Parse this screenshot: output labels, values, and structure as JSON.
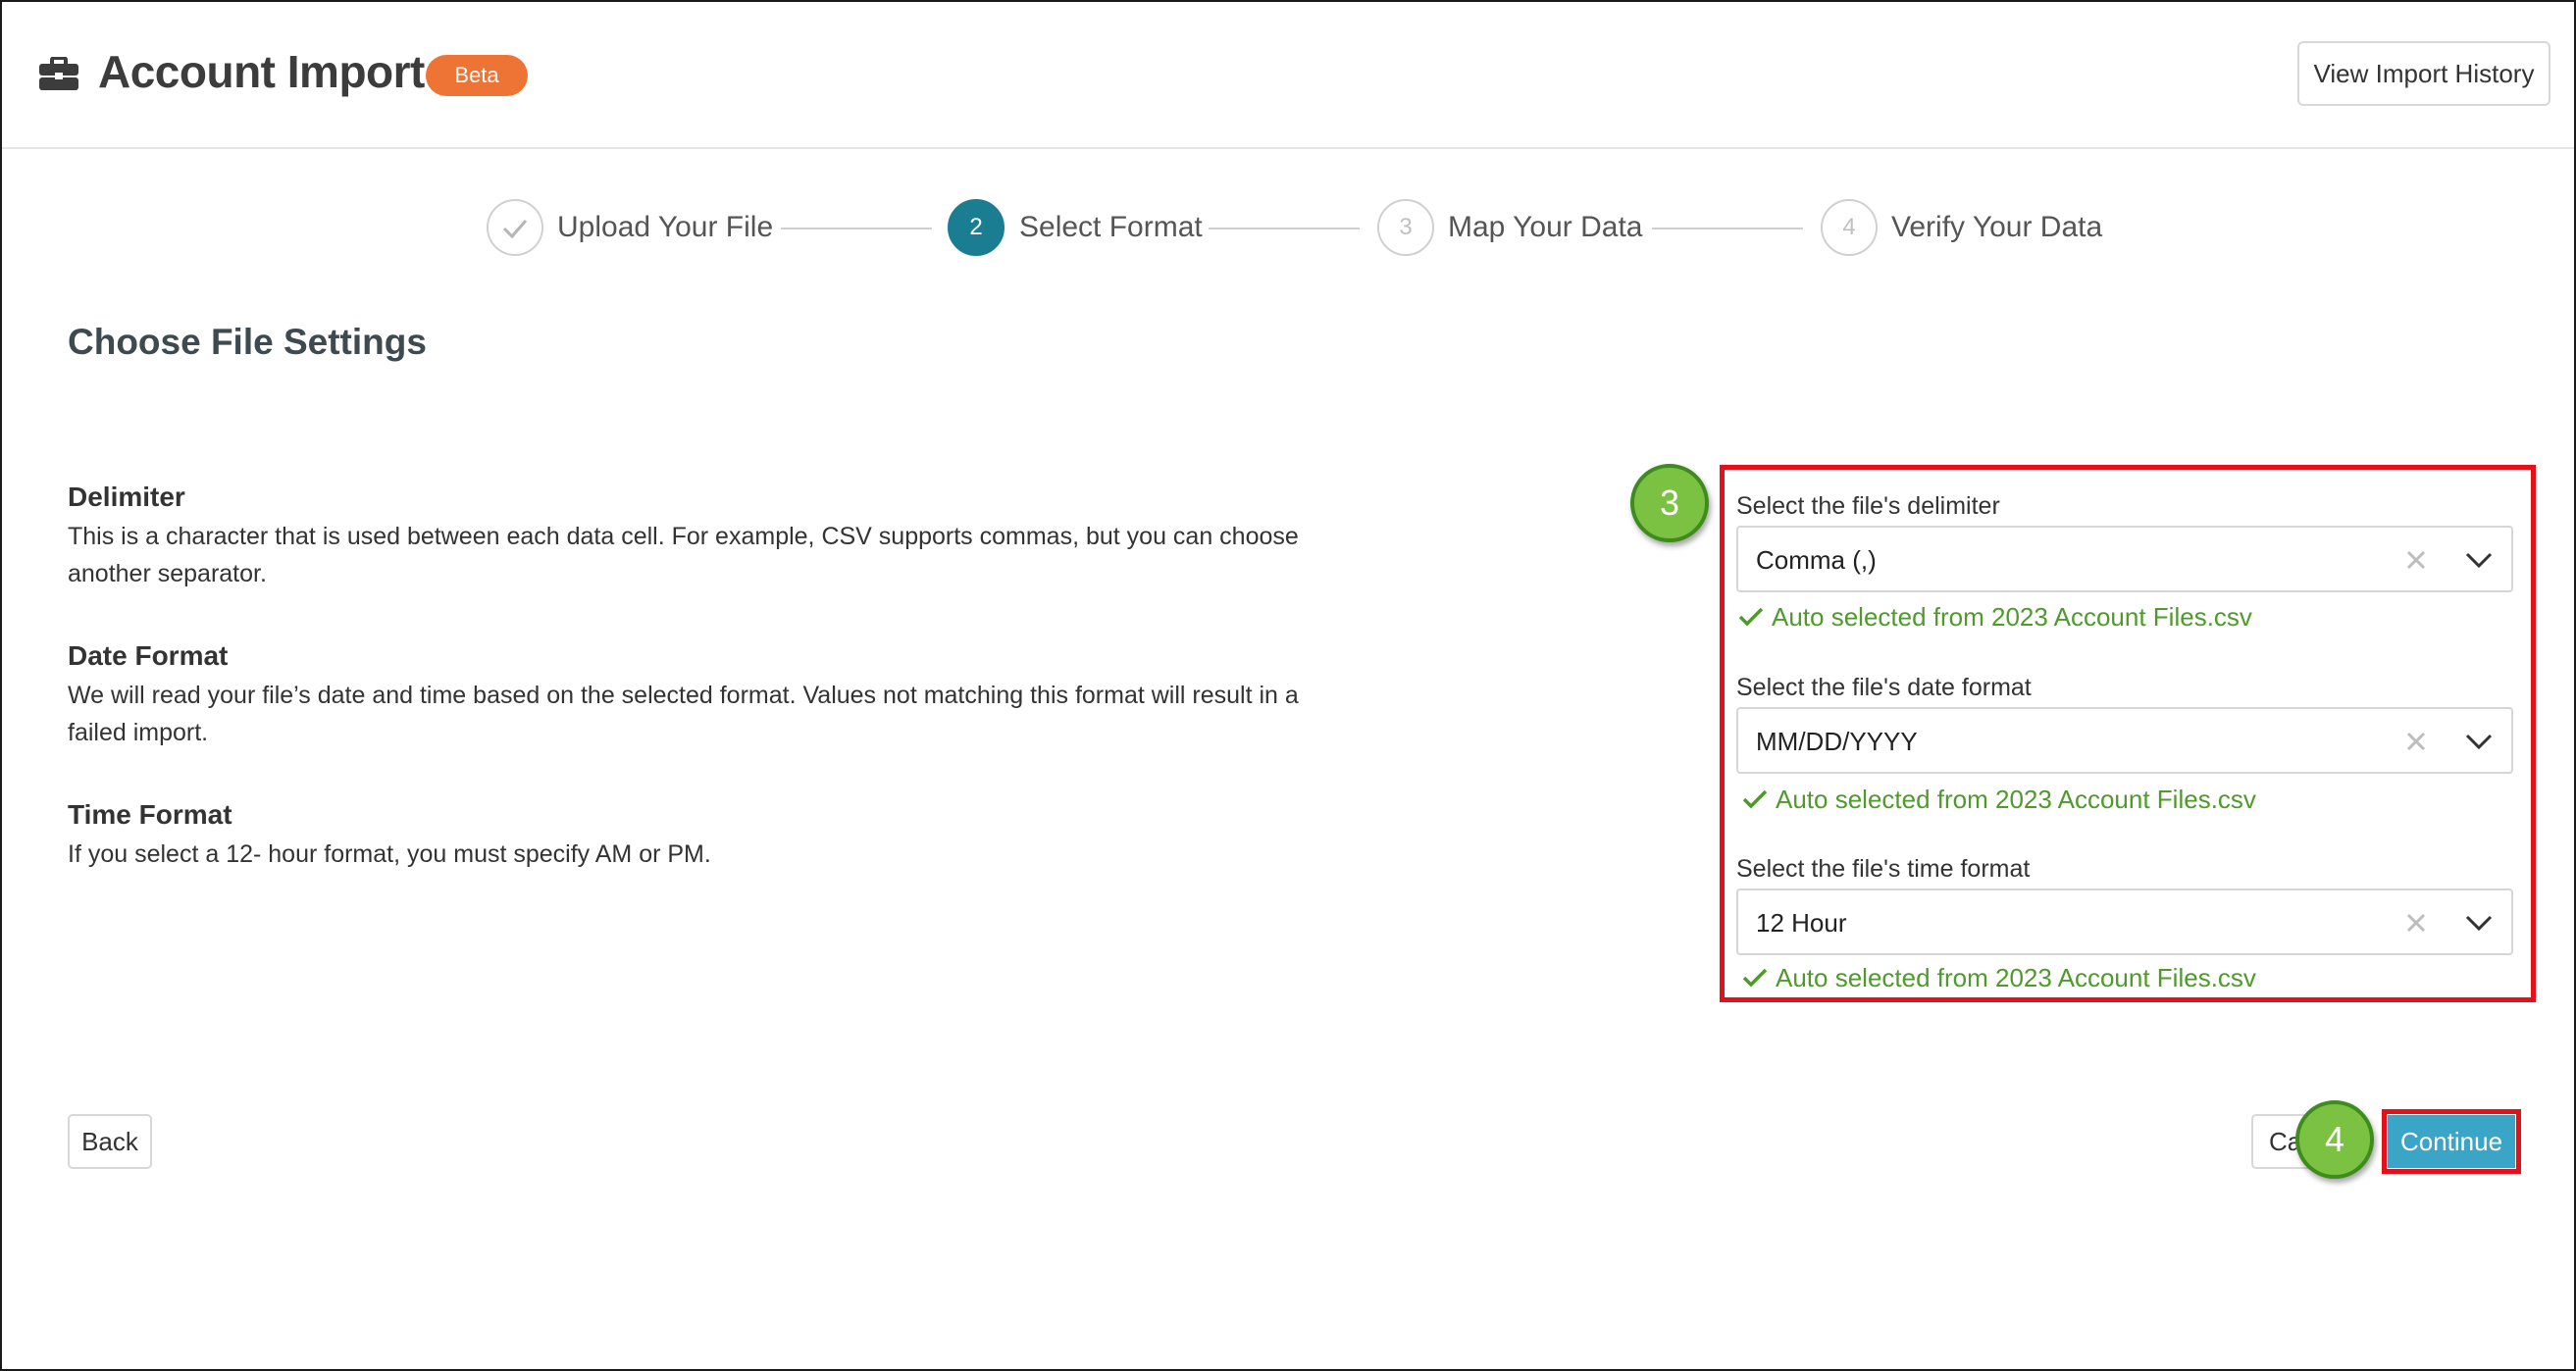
{
  "header": {
    "title": "Account Import",
    "badge": "Beta",
    "history_button": "View Import History"
  },
  "steps": [
    {
      "number": "",
      "label": "Upload Your File",
      "state": "completed"
    },
    {
      "number": "2",
      "label": "Select Format",
      "state": "active"
    },
    {
      "number": "3",
      "label": "Map Your Data",
      "state": "upcoming"
    },
    {
      "number": "4",
      "label": "Verify Your Data",
      "state": "upcoming"
    }
  ],
  "main": {
    "section_title": "Choose File Settings",
    "info": [
      {
        "heading": "Delimiter",
        "text": "This is a character that is used between each data cell. For example, CSV supports commas, but you can choose another separator."
      },
      {
        "heading": "Date Format",
        "text": "We will read your file’s date and time based on the selected format. Values not matching this format will result in a failed import."
      },
      {
        "heading": "Time Format",
        "text": "If you select a 12- hour format, you must specify AM or PM."
      }
    ]
  },
  "settings": {
    "delimiter": {
      "label": "Select the file's delimiter",
      "value": "Comma (,)",
      "note": "Auto selected from 2023 Account Files.csv"
    },
    "date_format": {
      "label": "Select the file's date format",
      "value": "MM/DD/YYYY",
      "note": "Auto selected from 2023 Account Files.csv"
    },
    "time_format": {
      "label": "Select the file's time format",
      "value": "12 Hour",
      "note": "Auto selected from 2023 Account Files.csv"
    }
  },
  "callouts": {
    "first": "3",
    "second": "4"
  },
  "footer": {
    "back": "Back",
    "cancel": "Ca",
    "continue": "Continue"
  },
  "colors": {
    "accent_step": "#1a7d91",
    "badge": "#ee7435",
    "success": "#4e9a2a",
    "continue": "#3aa5c7",
    "highlight": "#e5111a",
    "callout": "#7cc242"
  }
}
